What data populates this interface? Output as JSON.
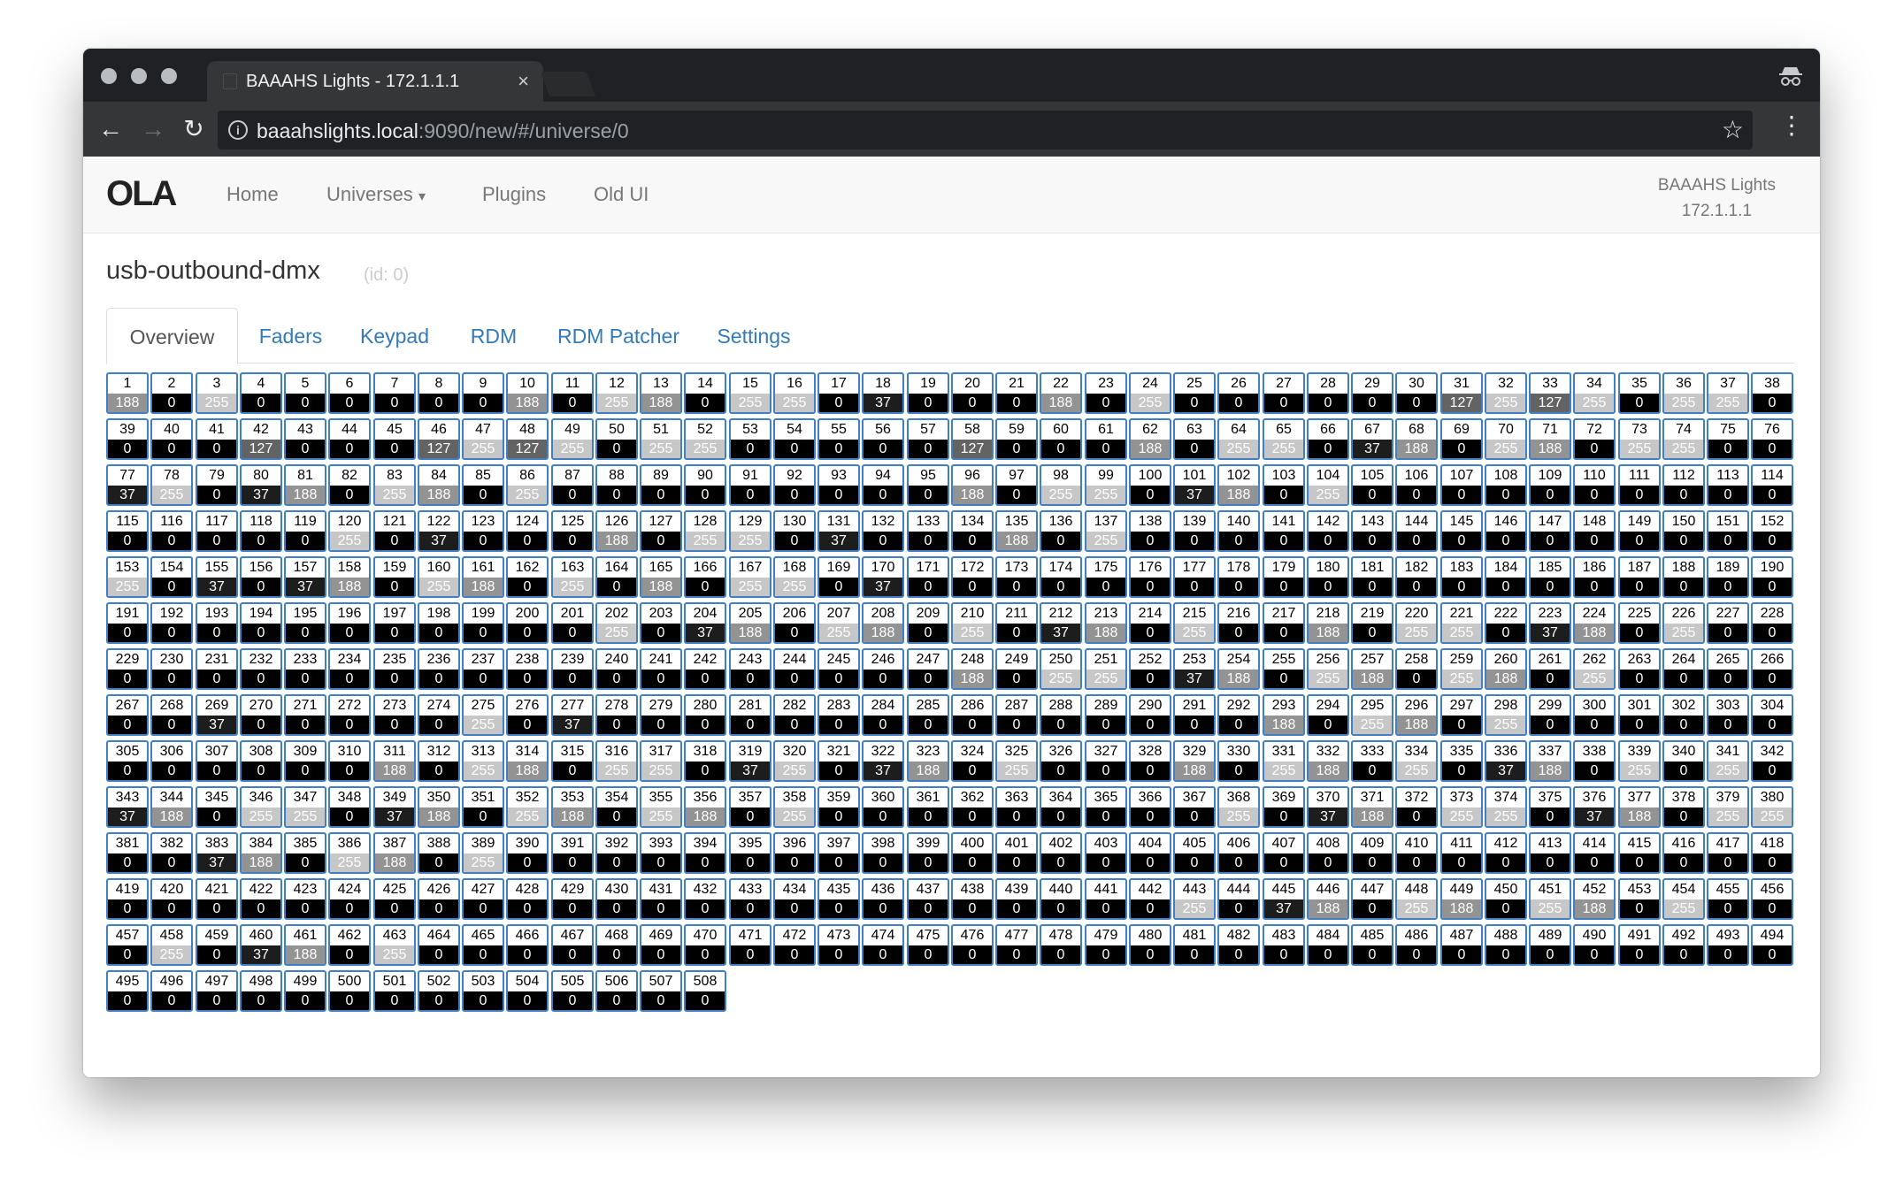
{
  "browser": {
    "tab_title": "BAAAHS Lights - 172.1.1.1",
    "tab_close": "×",
    "back": "←",
    "forward": "→",
    "reload": "↻",
    "url_host": "baaahslights.local",
    "url_path": ":9090/new/#/universe/0",
    "info": "i",
    "star": "☆",
    "menu": "⋮",
    "icons": [
      "incognito-icon",
      "info-icon",
      "star-icon"
    ]
  },
  "nav": {
    "logo": "OLA",
    "links": [
      "Home",
      "Universes",
      "Plugins",
      "Old UI"
    ],
    "caret": "▾",
    "brand_name": "BAAAHS Lights",
    "brand_ip": "172.1.1.1"
  },
  "universe": {
    "name": "usb-outbound-dmx",
    "id": "(id: 0)"
  },
  "tabs": [
    "Overview",
    "Faders",
    "Keypad",
    "RDM",
    "RDM Patcher",
    "Settings"
  ],
  "active_tab": "Overview",
  "colors": {
    "accent": "#337ab7",
    "cell_border": "#3f7fc2"
  },
  "dmx": {
    "columns": 38,
    "values": [
      188,
      0,
      255,
      0,
      0,
      0,
      0,
      0,
      0,
      188,
      0,
      255,
      188,
      0,
      255,
      255,
      0,
      37,
      0,
      0,
      0,
      188,
      0,
      255,
      0,
      0,
      0,
      0,
      0,
      0,
      127,
      255,
      127,
      255,
      0,
      255,
      255,
      0,
      0,
      0,
      0,
      127,
      0,
      0,
      0,
      127,
      255,
      127,
      255,
      0,
      255,
      255,
      0,
      0,
      0,
      0,
      0,
      127,
      0,
      0,
      0,
      188,
      0,
      255,
      255,
      0,
      37,
      188,
      0,
      255,
      188,
      0,
      255,
      255,
      0,
      0,
      37,
      255,
      0,
      37,
      188,
      0,
      255,
      188,
      0,
      255,
      0,
      0,
      0,
      0,
      0,
      0,
      0,
      0,
      0,
      188,
      0,
      255,
      255,
      0,
      37,
      188,
      0,
      255,
      0,
      0,
      0,
      0,
      0,
      0,
      0,
      0,
      0,
      0,
      0,
      0,
      0,
      0,
      0,
      255,
      0,
      37,
      0,
      0,
      0,
      188,
      0,
      255,
      255,
      0,
      37,
      0,
      0,
      0,
      188,
      0,
      255,
      0,
      0,
      0,
      0,
      0,
      0,
      0,
      0,
      0,
      0,
      0,
      0,
      0,
      0,
      0,
      255,
      0,
      37,
      0,
      37,
      188,
      0,
      255,
      188,
      0,
      255,
      0,
      188,
      0,
      255,
      255,
      0,
      37,
      0,
      0,
      0,
      0,
      0,
      0,
      0,
      0,
      0,
      0,
      0,
      0,
      0,
      0,
      0,
      0,
      0,
      0,
      0,
      0,
      0,
      0,
      0,
      0,
      0,
      0,
      0,
      0,
      0,
      0,
      0,
      255,
      0,
      37,
      188,
      0,
      255,
      188,
      0,
      255,
      0,
      37,
      188,
      0,
      255,
      0,
      0,
      188,
      0,
      255,
      255,
      0,
      37,
      188,
      0,
      255,
      0,
      0,
      0,
      0,
      0,
      0,
      0,
      0,
      0,
      0,
      0,
      0,
      0,
      0,
      0,
      0,
      0,
      0,
      0,
      0,
      0,
      188,
      0,
      255,
      255,
      0,
      37,
      188,
      0,
      255,
      188,
      0,
      255,
      188,
      0,
      255,
      0,
      0,
      0,
      0,
      0,
      0,
      37,
      0,
      0,
      0,
      0,
      0,
      255,
      0,
      37,
      0,
      0,
      0,
      0,
      0,
      0,
      0,
      0,
      0,
      0,
      0,
      0,
      0,
      0,
      0,
      188,
      0,
      255,
      188,
      0,
      255,
      0,
      0,
      0,
      0,
      0,
      0,
      0,
      0,
      0,
      0,
      0,
      0,
      188,
      0,
      255,
      188,
      0,
      255,
      255,
      0,
      37,
      255,
      0,
      37,
      188,
      0,
      255,
      0,
      0,
      0,
      188,
      0,
      255,
      188,
      0,
      255,
      0,
      37,
      188,
      0,
      255,
      0,
      255,
      0,
      37,
      188,
      0,
      255,
      255,
      0,
      37,
      188,
      0,
      255,
      188,
      0,
      255,
      188,
      0,
      255,
      0,
      0,
      0,
      0,
      0,
      0,
      0,
      0,
      0,
      255,
      0,
      37,
      188,
      0,
      255,
      255,
      0,
      37,
      188,
      0,
      255,
      255,
      0,
      0,
      37,
      188,
      0,
      255,
      188,
      0,
      255,
      0,
      0,
      0,
      0,
      0,
      0,
      0,
      0,
      0,
      0,
      0,
      0,
      0,
      0,
      0,
      0,
      0,
      0,
      0,
      0,
      0,
      0,
      0,
      0,
      0,
      0,
      0,
      0,
      0,
      0,
      0,
      0,
      0,
      0,
      0,
      0,
      0,
      0,
      0,
      0,
      0,
      0,
      0,
      0,
      0,
      0,
      0,
      0,
      0,
      0,
      0,
      0,
      0,
      255,
      0,
      37,
      188,
      0,
      255,
      188,
      0,
      255,
      188,
      0,
      255,
      0,
      0,
      0,
      255,
      0,
      37,
      188,
      0,
      255,
      0,
      0,
      0,
      0,
      0,
      0,
      0,
      0,
      0,
      0,
      0,
      0,
      0,
      0,
      0,
      0,
      0,
      0,
      0,
      0,
      0,
      0,
      0,
      0,
      0,
      0,
      0,
      0,
      0,
      0,
      0,
      0,
      0,
      0,
      0,
      0,
      0,
      0,
      0,
      0,
      0,
      0,
      0,
      0,
      0
    ]
  }
}
